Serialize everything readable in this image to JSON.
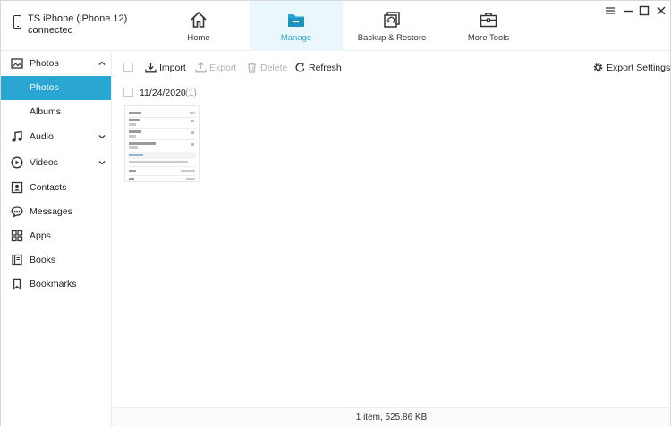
{
  "device": {
    "name": "TS iPhone (iPhone 12)",
    "status": "connected",
    "icon": "phone-icon"
  },
  "nav": {
    "tabs": [
      {
        "label": "Home",
        "icon": "home-icon",
        "active": false
      },
      {
        "label": "Manage",
        "icon": "folder-icon",
        "active": true
      },
      {
        "label": "Backup & Restore",
        "icon": "backup-restore-icon",
        "active": false
      },
      {
        "label": "More Tools",
        "icon": "toolbox-icon",
        "active": false
      }
    ]
  },
  "window_controls": [
    "menu-icon",
    "minimize-icon",
    "maximize-icon",
    "close-icon"
  ],
  "sidebar": {
    "items": [
      {
        "label": "Photos",
        "icon": "image-icon",
        "expanded": true
      },
      {
        "label": "Photos",
        "sub": true,
        "active": true
      },
      {
        "label": "Albums",
        "sub": true,
        "active": false
      },
      {
        "label": "Audio",
        "icon": "music-note-icon",
        "expanded": false
      },
      {
        "label": "Videos",
        "icon": "play-circle-icon",
        "expanded": false
      },
      {
        "label": "Contacts",
        "icon": "contact-card-icon"
      },
      {
        "label": "Messages",
        "icon": "chat-bubble-icon"
      },
      {
        "label": "Apps",
        "icon": "apps-grid-icon"
      },
      {
        "label": "Books",
        "icon": "book-icon"
      },
      {
        "label": "Bookmarks",
        "icon": "bookmark-icon"
      }
    ]
  },
  "toolbar": {
    "import": "Import",
    "export": "Export",
    "delete": "Delete",
    "refresh": "Refresh",
    "export_settings": "Export Settings"
  },
  "content": {
    "groups": [
      {
        "date": "11/24/2020",
        "count": "(1)"
      }
    ]
  },
  "status": {
    "text": "1 item, 525.86 KB"
  },
  "colors": {
    "accent": "#2aa6d2",
    "active_tab_bg": "#eaf7fb",
    "disabled": "#b4b4b4"
  }
}
